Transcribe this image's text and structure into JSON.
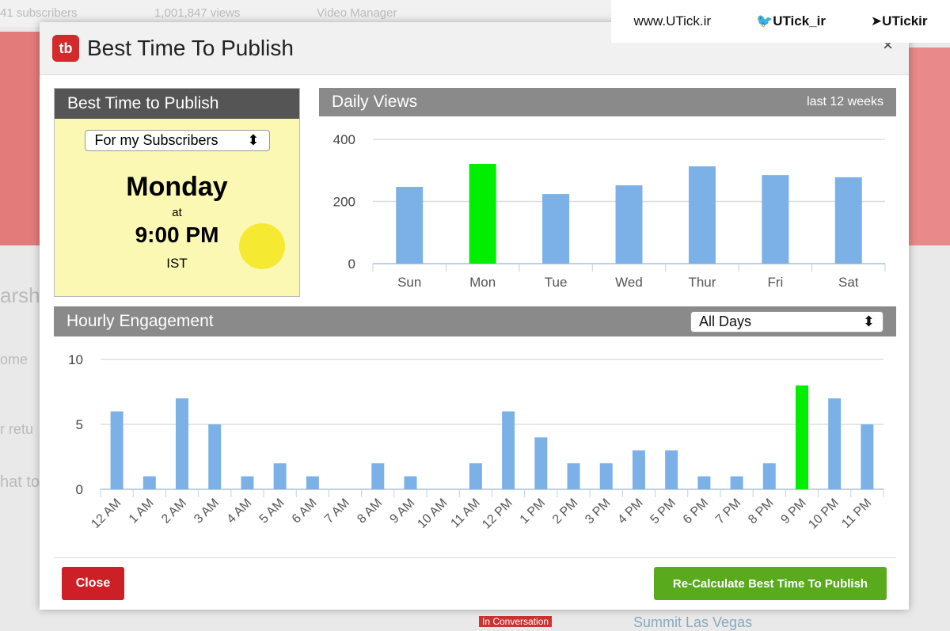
{
  "background": {
    "subscribers": "41 subscribers",
    "views": "1,001,847 views",
    "video_manager": "Video Manager",
    "fragments": [
      "arsh",
      "ome",
      "r retu",
      "hat to"
    ],
    "footer_left": "In Conversation",
    "footer_right": "Summit Las Vegas"
  },
  "watermark": {
    "site": "www.UTick.ir",
    "twitter": "UTick_ir",
    "telegram": "UTickir"
  },
  "modal": {
    "logo": "tb",
    "title": "Best Time To Publish",
    "close_icon": "×"
  },
  "best_time": {
    "header": "Best Time to Publish",
    "audience": "For my Subscribers",
    "day": "Monday",
    "at": "at",
    "time": "9:00 PM",
    "timezone": "IST"
  },
  "daily": {
    "header": "Daily Views",
    "range": "last 12 weeks"
  },
  "hourly": {
    "header": "Hourly Engagement",
    "filter": "All Days"
  },
  "buttons": {
    "close": "Close",
    "recalculate": "Re-Calculate Best Time To Publish"
  },
  "colors": {
    "bar": "#7cb1e8",
    "highlight": "#00ee00",
    "close": "#cc1f26",
    "recalc": "#5aaa1e"
  },
  "chart_data": [
    {
      "type": "bar",
      "title": "Daily Views",
      "categories": [
        "Sun",
        "Mon",
        "Tue",
        "Wed",
        "Thur",
        "Fri",
        "Sat"
      ],
      "values": [
        247,
        321,
        224,
        252,
        313,
        285,
        278
      ],
      "highlight": "Mon",
      "ylim": [
        0,
        400
      ],
      "yticks": [
        0,
        200,
        400
      ],
      "grid": true
    },
    {
      "type": "bar",
      "title": "Hourly Engagement",
      "categories": [
        "12 AM",
        "1 AM",
        "2 AM",
        "3 AM",
        "4 AM",
        "5 AM",
        "6 AM",
        "7 AM",
        "8 AM",
        "9 AM",
        "10 AM",
        "11 AM",
        "12 PM",
        "1 PM",
        "2 PM",
        "3 PM",
        "4 PM",
        "5 PM",
        "6 PM",
        "7 PM",
        "8 PM",
        "9 PM",
        "10 PM",
        "11 PM"
      ],
      "values": [
        6,
        1,
        7,
        5,
        1,
        2,
        1,
        0,
        2,
        1,
        0,
        2,
        6,
        4,
        2,
        2,
        3,
        3,
        1,
        1,
        2,
        8,
        7,
        5
      ],
      "highlight": "9 PM",
      "ylim": [
        0,
        10
      ],
      "yticks": [
        0,
        5,
        10
      ],
      "grid": true
    }
  ]
}
